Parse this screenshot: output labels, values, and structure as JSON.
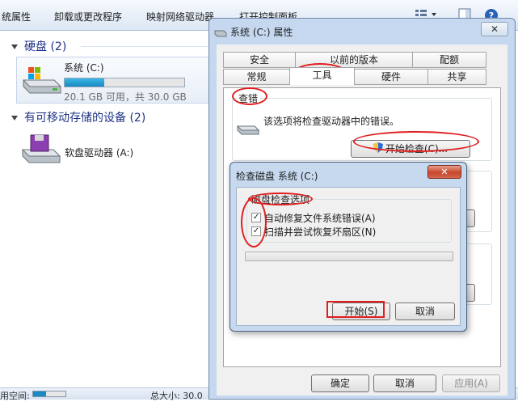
{
  "explorer": {
    "toolbar": {
      "system_properties": "统属性",
      "uninstall": "卸载或更改程序",
      "map_drive": "映射网络驱动器",
      "control_panel": "打开控制面板"
    },
    "hard_disk_group": "硬盘 (2)",
    "drive_c": {
      "name": "系统 (C:)",
      "space": "20.1 GB 可用，共 30.0 GB",
      "used_fraction": 0.33
    },
    "removable_group": "有可移动存储的设备 (2)",
    "floppy": "软盘驱动器 (A:)",
    "status": {
      "left": "用空间:",
      "right": "总大小: 30.0"
    },
    "colors": {
      "header_text": "#1e3287",
      "capacity_fill": "#1a8ac2"
    }
  },
  "props": {
    "title": "系统 (C:) 属性",
    "close": "✕",
    "tabs": {
      "security": "安全",
      "previous": "以前的版本",
      "quota": "配额",
      "general": "常规",
      "tools": "工具",
      "hardware": "硬件",
      "sharing": "共享"
    },
    "check_section": "查错",
    "check_desc": "该选项将检查驱动器中的错误。",
    "check_button": "开始检查(C)...",
    "ok": "确定",
    "cancel": "取消",
    "apply": "应用(A)"
  },
  "chkdsk": {
    "title": "检查磁盘 系统 (C:)",
    "close": "✕",
    "options_group": "磁盘检查选项",
    "opt1": {
      "label": "自动修复文件系统错误(A)",
      "checked": "✓"
    },
    "opt2": {
      "label": "扫描并尝试恢复坏扇区(N)",
      "checked": "✓"
    },
    "progress": 0,
    "start": "开始(S)",
    "cancel": "取消"
  },
  "annotation_color": "#e01e1e"
}
